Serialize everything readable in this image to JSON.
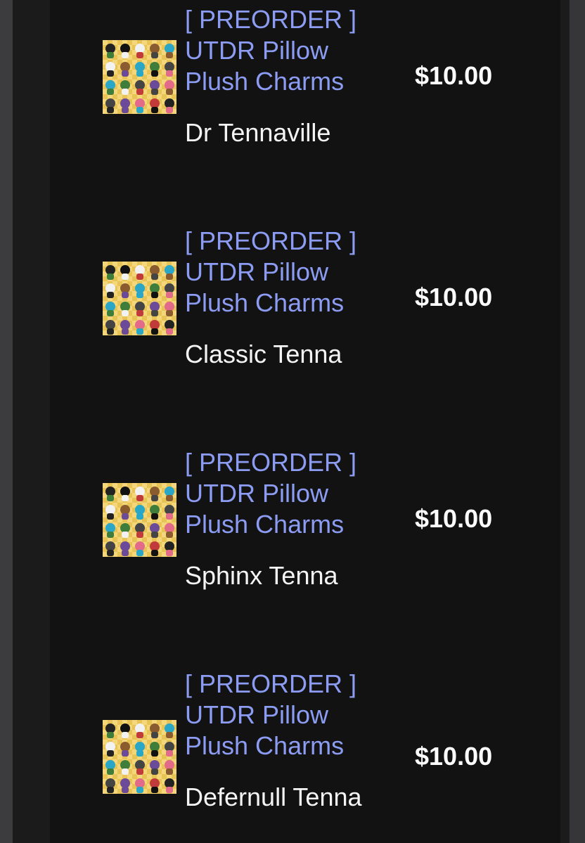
{
  "cart": {
    "items": [
      {
        "title_lines": [
          "[ PREORDER ]",
          "UTDR Pillow",
          "Plush Charms"
        ],
        "variant": "Dr Tennaville",
        "price": "$10.00",
        "thumbnail": "plush-charms-product-image"
      },
      {
        "title_lines": [
          "[ PREORDER ]",
          "UTDR Pillow",
          "Plush Charms"
        ],
        "variant": "Classic Tenna",
        "price": "$10.00",
        "thumbnail": "plush-charms-product-image"
      },
      {
        "title_lines": [
          "[ PREORDER ]",
          "UTDR Pillow",
          "Plush Charms"
        ],
        "variant": "Sphinx Tenna",
        "price": "$10.00",
        "thumbnail": "plush-charms-product-image"
      },
      {
        "title_lines": [
          "[ PREORDER ]",
          "UTDR Pillow",
          "Plush Charms"
        ],
        "variant": "Defernull Tenna",
        "price": "$10.00",
        "thumbnail": "plush-charms-product-image"
      }
    ]
  },
  "colors": {
    "background": "#121213",
    "link": "#8c9cf2",
    "text": "#f4f4f4",
    "thumbnail_bg": "#f4d77a"
  }
}
